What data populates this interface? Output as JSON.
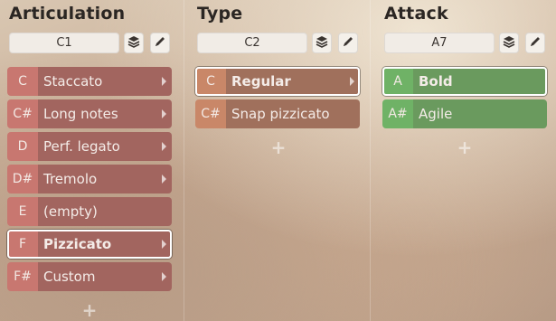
{
  "columns": [
    {
      "title": "Articulation",
      "key_value": "C1",
      "items": [
        {
          "key": "C",
          "label": "Staccato",
          "selected": false
        },
        {
          "key": "C#",
          "label": "Long notes",
          "selected": false
        },
        {
          "key": "D",
          "label": "Perf. legato",
          "selected": false
        },
        {
          "key": "D#",
          "label": "Tremolo",
          "selected": false
        },
        {
          "key": "E",
          "label": "(empty)",
          "selected": false
        },
        {
          "key": "F",
          "label": "Pizzicato",
          "selected": true
        },
        {
          "key": "F#",
          "label": "Custom",
          "selected": false
        }
      ],
      "add_label": "+"
    },
    {
      "title": "Type",
      "key_value": "C2",
      "items": [
        {
          "key": "C",
          "label": "Regular",
          "selected": true
        },
        {
          "key": "C#",
          "label": "Snap pizzicato",
          "selected": false
        }
      ],
      "add_label": "+"
    },
    {
      "title": "Attack",
      "key_value": "A7",
      "items": [
        {
          "key": "A",
          "label": "Bold",
          "selected": true
        },
        {
          "key": "A#",
          "label": "Agile",
          "selected": false
        }
      ],
      "add_label": "+"
    }
  ],
  "icons": {
    "layers": "layers-icon",
    "edit": "pencil-icon"
  },
  "colors": {
    "articulation_key": "#c87770",
    "articulation_label": "#a2655f",
    "type_key": "#c98768",
    "type_label": "#a0705c",
    "attack_key": "#6fb266",
    "attack_label": "#6a9a5e"
  }
}
